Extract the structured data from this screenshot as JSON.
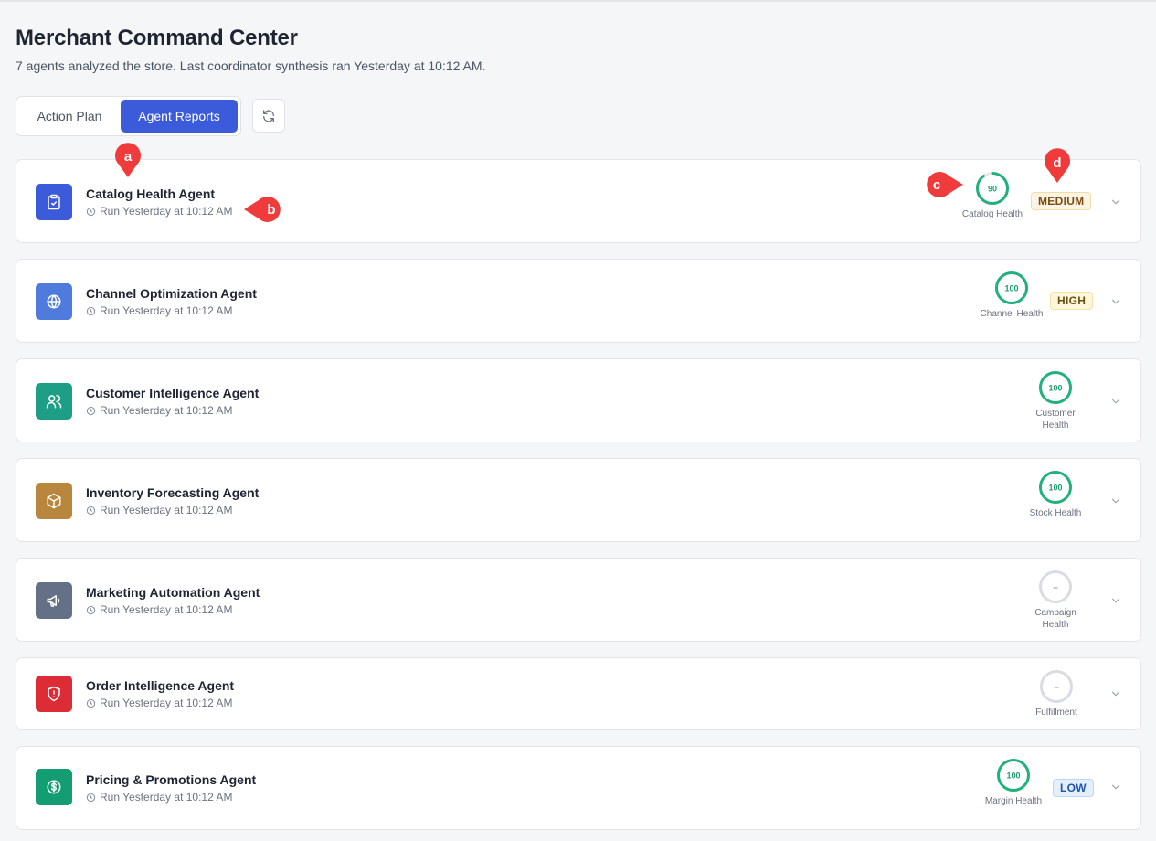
{
  "header": {
    "title": "Merchant Command Center",
    "subtitle": "7 agents analyzed the store. Last coordinator synthesis ran Yesterday at 10:12 AM."
  },
  "tabs": [
    {
      "label": "Action Plan",
      "active": false
    },
    {
      "label": "Agent Reports",
      "active": true
    }
  ],
  "refresh_icon": "refresh-icon",
  "agents": [
    {
      "name": "Catalog Health Agent",
      "run": "Run Yesterday at 10:12 AM",
      "icon": "clipboard-check-icon",
      "color": "#3b5bdb",
      "score": "90",
      "score_fraction": 0.9,
      "score_label": "Catalog Health",
      "priority": "MEDIUM"
    },
    {
      "name": "Channel Optimization Agent",
      "run": "Run Yesterday at 10:12 AM",
      "icon": "globe-icon",
      "color": "#4f7bdc",
      "score": "100",
      "score_fraction": 1.0,
      "score_label": "Channel Health",
      "priority": "HIGH"
    },
    {
      "name": "Customer Intelligence Agent",
      "run": "Run Yesterday at 10:12 AM",
      "icon": "users-icon",
      "color": "#1e9e86",
      "score": "100",
      "score_fraction": 1.0,
      "score_label": "Customer Health",
      "priority": ""
    },
    {
      "name": "Inventory Forecasting Agent",
      "run": "Run Yesterday at 10:12 AM",
      "icon": "box-icon",
      "color": "#b8863c",
      "score": "100",
      "score_fraction": 1.0,
      "score_label": "Stock Health",
      "priority": ""
    },
    {
      "name": "Marketing Automation Agent",
      "run": "Run Yesterday at 10:12 AM",
      "icon": "megaphone-icon",
      "color": "#637085",
      "score": "–",
      "score_fraction": 0,
      "score_label": "Campaign Health",
      "priority": ""
    },
    {
      "name": "Order Intelligence Agent",
      "run": "Run Yesterday at 10:12 AM",
      "icon": "shield-alert-icon",
      "color": "#dc2d36",
      "score": "–",
      "score_fraction": 0,
      "score_label": "Fulfillment",
      "priority": ""
    },
    {
      "name": "Pricing & Promotions Agent",
      "run": "Run Yesterday at 10:12 AM",
      "icon": "dollar-circle-icon",
      "color": "#149c72",
      "score": "100",
      "score_fraction": 1.0,
      "score_label": "Margin Health",
      "priority": "LOW"
    }
  ],
  "colors": {
    "accent": "#3b5bdb",
    "score_ring": "#22b07d",
    "score_empty": "#d9dce2",
    "annotation": "#ef3b3b"
  },
  "annotations": [
    {
      "letter": "a"
    },
    {
      "letter": "b"
    },
    {
      "letter": "c"
    },
    {
      "letter": "d"
    }
  ]
}
